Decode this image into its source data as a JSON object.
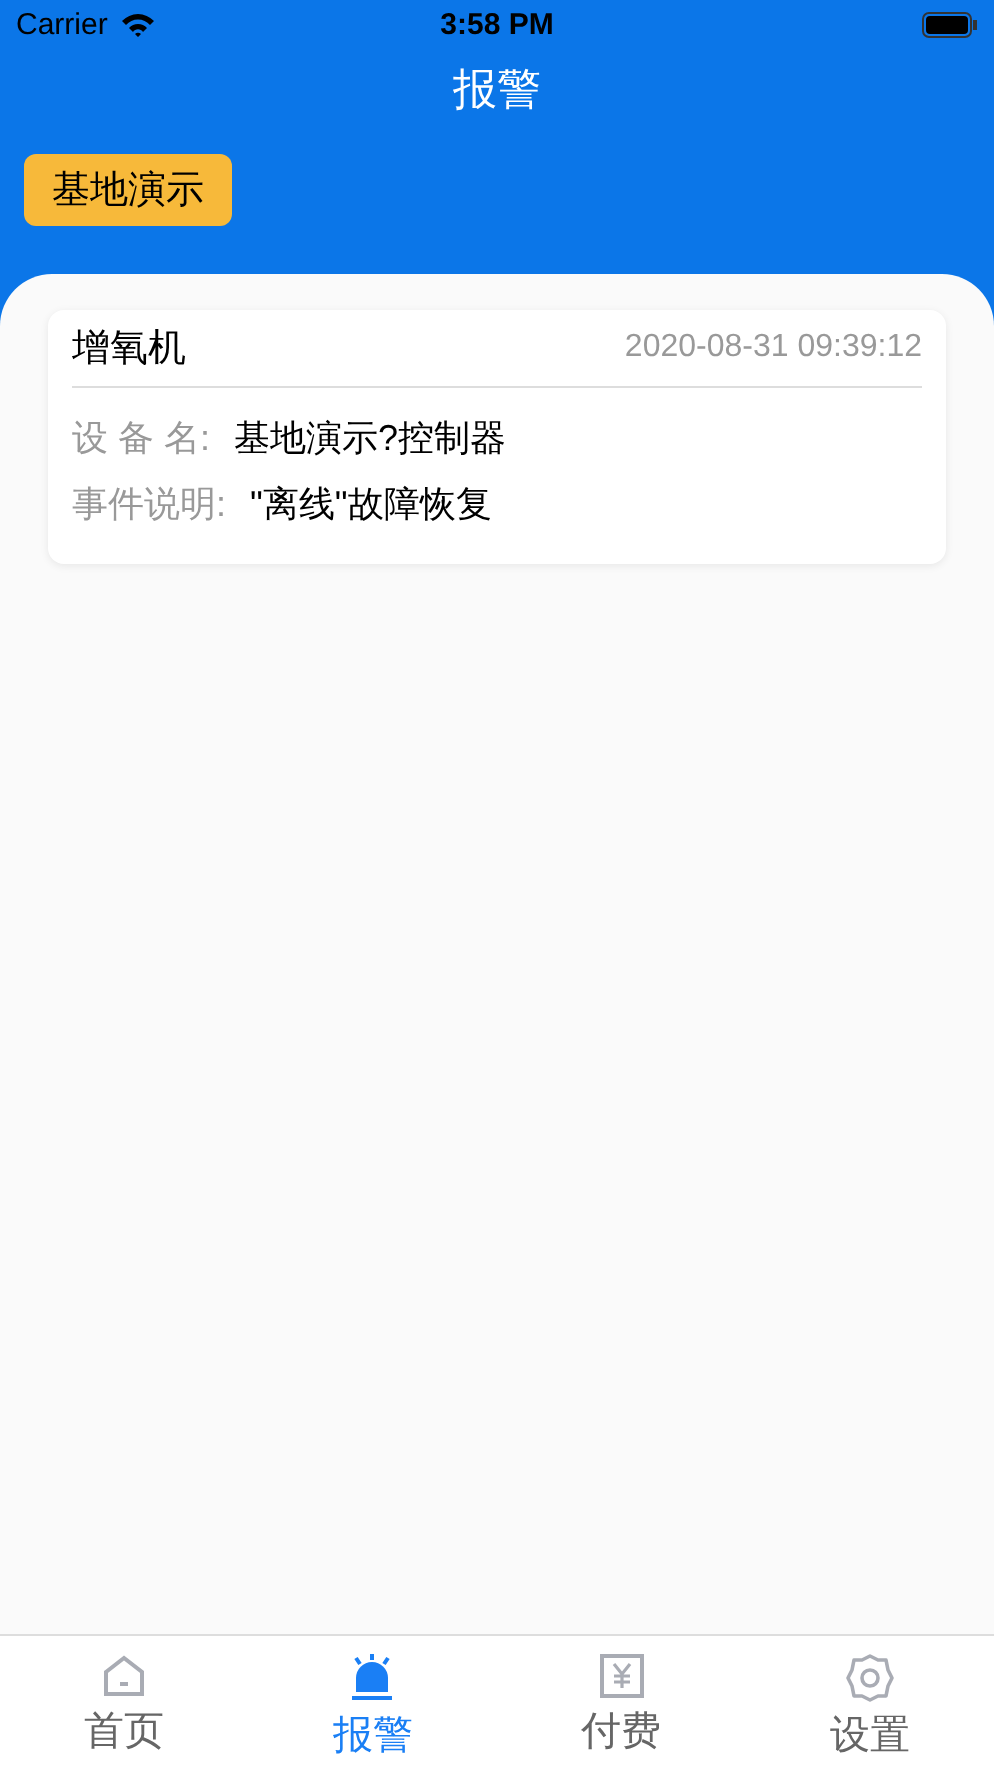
{
  "status_bar": {
    "carrier": "Carrier",
    "time": "3:58 PM"
  },
  "nav": {
    "title": "报警"
  },
  "filter_button": {
    "label": "基地演示"
  },
  "alarms": [
    {
      "device_type": "增氧机",
      "time": "2020-08-31 09:39:12",
      "fields": [
        {
          "label": "设 备 名:",
          "value": "基地演示?控制器"
        },
        {
          "label": "事件说明:",
          "value": "\"离线\"故障恢复"
        }
      ]
    }
  ],
  "tab_bar": [
    {
      "label": "首页",
      "kind": "home",
      "selected": false
    },
    {
      "label": "报警",
      "kind": "alarm",
      "selected": true
    },
    {
      "label": "付费",
      "kind": "pay",
      "selected": false
    },
    {
      "label": "设置",
      "kind": "settings",
      "selected": false
    }
  ]
}
